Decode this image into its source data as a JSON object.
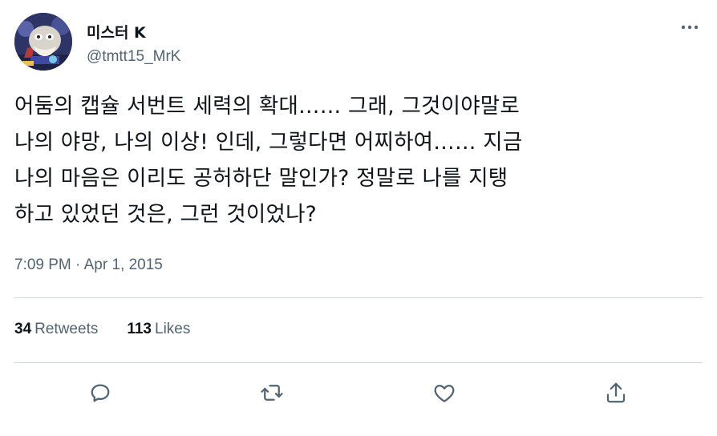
{
  "author": {
    "display_name": "미스터 K",
    "handle": "@tmtt15_MrK"
  },
  "tweet": {
    "text": "어둠의 캡슐 서번트 세력의 확대…… 그래, 그것이야말로\n나의 야망, 나의 이상! 인데, 그렇다면 어찌하여…… 지금\n나의 마음은 이리도 공허하단 말인가? 정말로 나를 지탱\n하고 있었던 것은, 그런 것이었나?",
    "timestamp": "7:09 PM · Apr 1, 2015"
  },
  "stats": {
    "retweets_count": "34",
    "retweets_label": "Retweets",
    "likes_count": "113",
    "likes_label": "Likes"
  },
  "icons": {
    "more": "more-horizontal-icon",
    "reply": "reply-icon",
    "retweet": "retweet-icon",
    "like": "heart-icon",
    "share": "share-icon"
  },
  "colors": {
    "text_primary": "#0f1419",
    "text_secondary": "#536471",
    "divider": "#cfd9de"
  }
}
